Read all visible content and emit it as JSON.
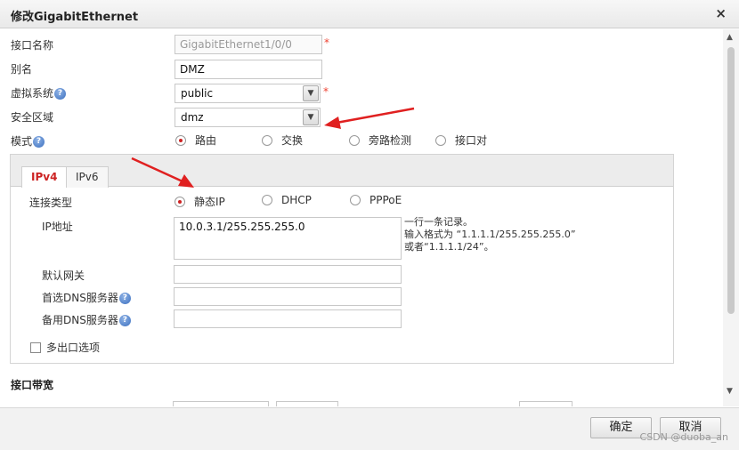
{
  "dialog": {
    "title": "修改GigabitEthernet",
    "close_glyph": "×"
  },
  "form": {
    "interface_name": {
      "label": "接口名称",
      "value": "GigabitEthernet1/0/0",
      "required": "*"
    },
    "alias": {
      "label": "别名",
      "value": "DMZ"
    },
    "virtual_system": {
      "label": "虚拟系统",
      "value": "public",
      "required": "*"
    },
    "security_zone": {
      "label": "安全区域",
      "value": "dmz"
    },
    "mode": {
      "label": "模式",
      "options": [
        "路由",
        "交换",
        "旁路检测",
        "接口对"
      ],
      "selected": "路由"
    }
  },
  "tabs": [
    "IPv4",
    "IPv6"
  ],
  "ipv4": {
    "connection_type": {
      "label": "连接类型",
      "options": [
        "静态IP",
        "DHCP",
        "PPPoE"
      ],
      "selected": "静态IP"
    },
    "ip_address": {
      "label": "IP地址",
      "value": "10.0.3.1/255.255.255.0"
    },
    "hint": [
      "一行一条记录。",
      "输入格式为 “1.1.1.1/255.255.255.0”",
      "或者“1.1.1.1/24”。"
    ],
    "gateway": {
      "label": "默认网关",
      "value": ""
    },
    "dns_primary": {
      "label": "首选DNS服务器",
      "value": ""
    },
    "dns_secondary": {
      "label": "备用DNS服务器",
      "value": ""
    },
    "multi_exit": {
      "label": "多出口选项"
    }
  },
  "bandwidth": {
    "label": "接口带宽"
  },
  "footer": {
    "ok": "确定",
    "cancel": "取消",
    "watermark": "CSDN @duoba_an"
  },
  "icons": {
    "help": "question-mark-icon",
    "dropdown": "chevron-down-icon",
    "scroll_up": "arrow-up-icon",
    "scroll_down": "arrow-down-icon",
    "annotation": "red-arrow-icon"
  },
  "colors": {
    "accent": "#cc2222",
    "required": "#ee4433",
    "help": "#3b6fbf"
  }
}
